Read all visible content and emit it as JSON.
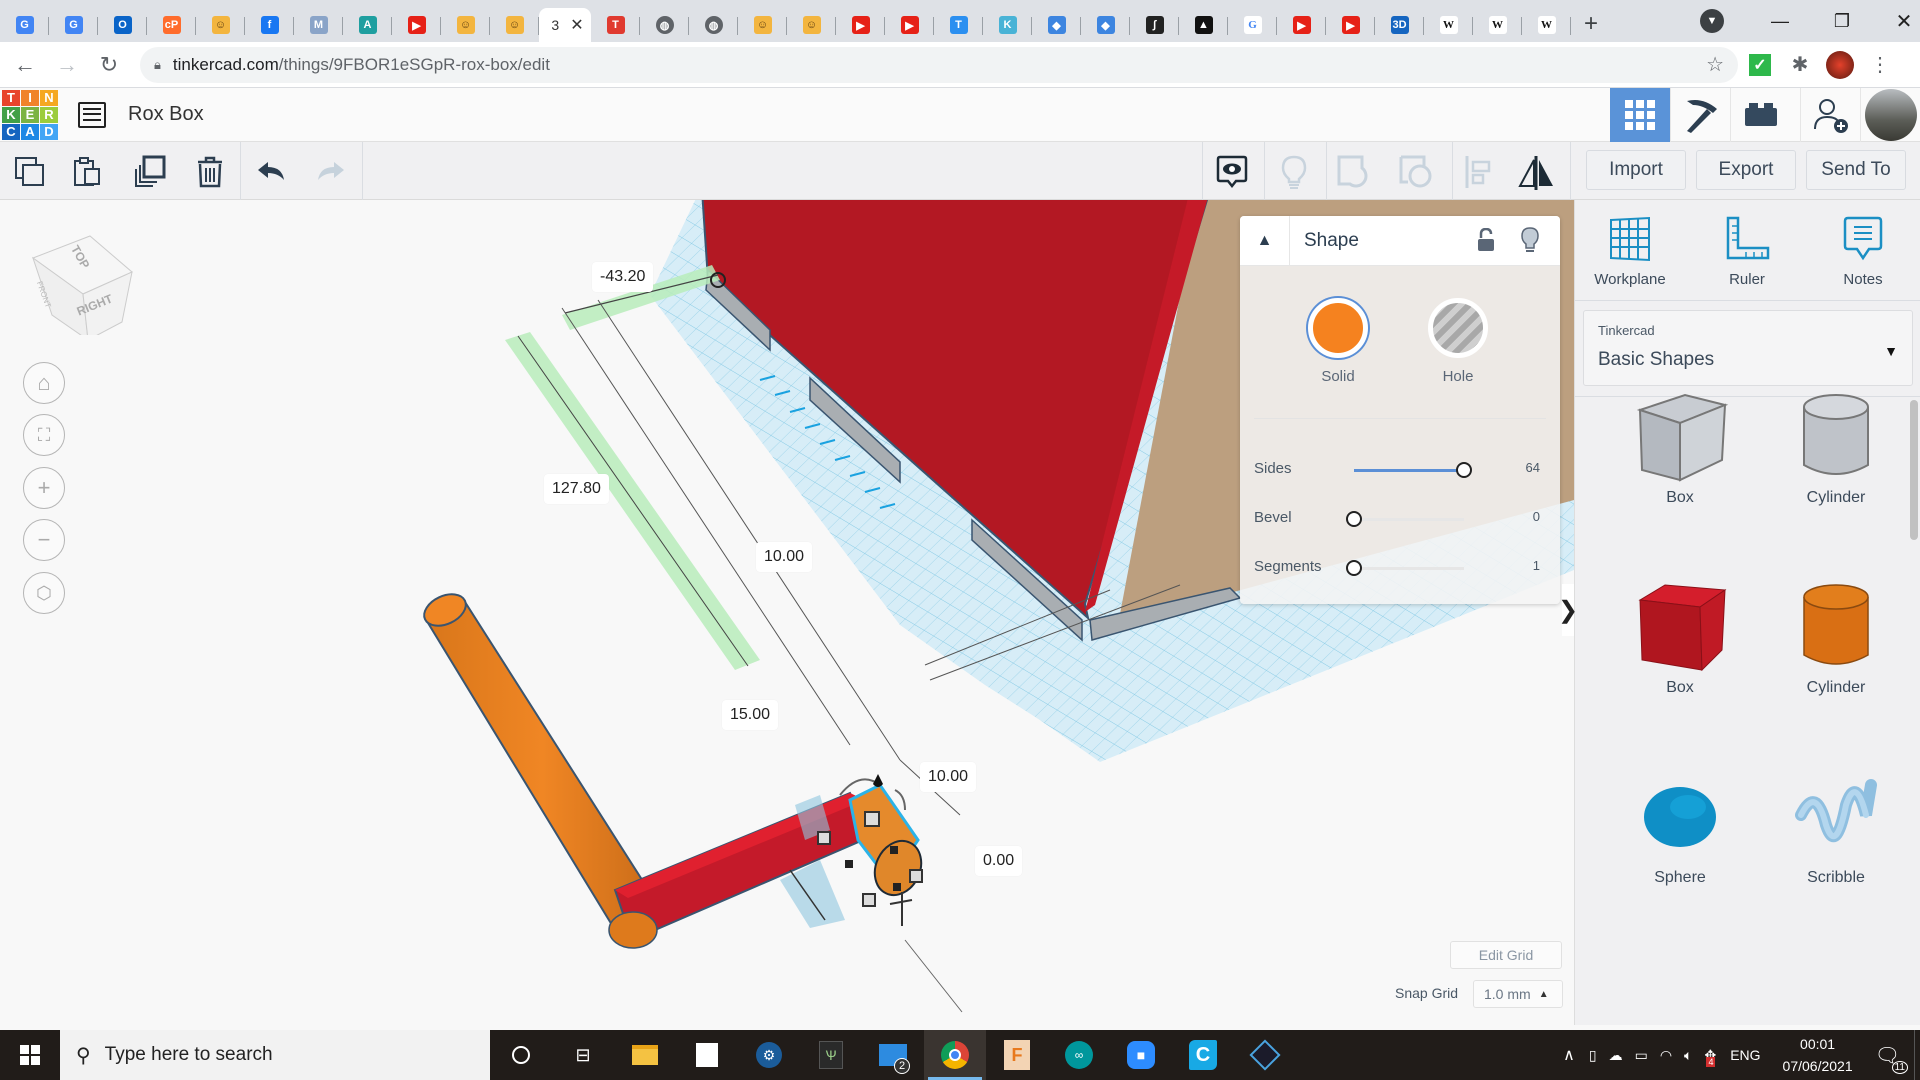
{
  "browser": {
    "tabs": [
      {
        "icon": "google-translate-icon",
        "color": "#4285f4",
        "glyph": "G"
      },
      {
        "icon": "google-translate-icon",
        "color": "#4285f4",
        "glyph": "G"
      },
      {
        "icon": "outlook-icon",
        "color": "#0a64c8",
        "glyph": "O"
      },
      {
        "icon": "cpanel-icon",
        "color": "#ff6c2c",
        "glyph": "cP"
      },
      {
        "icon": "robot-avatar-icon",
        "color": "#f3b53f",
        "glyph": "☺"
      },
      {
        "icon": "facebook-icon",
        "color": "#1877f2",
        "glyph": "f"
      },
      {
        "icon": "moodle-icon",
        "color": "#8aa4c8",
        "glyph": "M"
      },
      {
        "icon": "autodesk-icon",
        "color": "#1f9fa0",
        "glyph": "A"
      },
      {
        "icon": "youtube-icon",
        "color": "#e62117",
        "glyph": "▶"
      },
      {
        "icon": "robot-avatar-icon",
        "color": "#f3b53f",
        "glyph": "☺"
      },
      {
        "icon": "robot-avatar-icon",
        "color": "#f3b53f",
        "glyph": "☺"
      },
      {
        "icon": "active-tab",
        "color": "#ffffff",
        "glyph": "3",
        "active": true
      },
      {
        "icon": "tinkercad-icon",
        "color": "#e03a2f",
        "glyph": "T"
      },
      {
        "icon": "globe-icon",
        "color": "#5f6368",
        "glyph": "◍"
      },
      {
        "icon": "globe-icon",
        "color": "#5f6368",
        "glyph": "◍"
      },
      {
        "icon": "robot-avatar-icon",
        "color": "#f3b53f",
        "glyph": "☺"
      },
      {
        "icon": "robot-avatar-icon",
        "color": "#f3b53f",
        "glyph": "☺"
      },
      {
        "icon": "youtube-icon",
        "color": "#e62117",
        "glyph": "▶"
      },
      {
        "icon": "youtube-icon",
        "color": "#e62117",
        "glyph": "▶"
      },
      {
        "icon": "tinkercad-t-icon",
        "color": "#2b8ff0",
        "glyph": "T"
      },
      {
        "icon": "kidcode-icon",
        "color": "#49b3d6",
        "glyph": "K"
      },
      {
        "icon": "book-icon",
        "color": "#3d85e0",
        "glyph": "◆"
      },
      {
        "icon": "book-icon",
        "color": "#3d85e0",
        "glyph": "◆"
      },
      {
        "icon": "integral-icon",
        "color": "#222222",
        "glyph": "∫"
      },
      {
        "icon": "inkscape-icon",
        "color": "#111111",
        "glyph": "▲"
      },
      {
        "icon": "google-icon",
        "color": "#ffffff",
        "glyph": "G"
      },
      {
        "icon": "youtube-icon",
        "color": "#e62117",
        "glyph": "▶"
      },
      {
        "icon": "youtube-icon",
        "color": "#e62117",
        "glyph": "▶"
      },
      {
        "icon": "3d-icon",
        "color": "#1565c0",
        "glyph": "3D"
      },
      {
        "icon": "wikipedia-icon",
        "color": "#ffffff",
        "glyph": "W"
      },
      {
        "icon": "wikipedia-icon",
        "color": "#ffffff",
        "glyph": "W"
      },
      {
        "icon": "wikipedia-icon",
        "color": "#ffffff",
        "glyph": "W"
      }
    ],
    "active_tab_title": "3",
    "url_host": "tinkercad.com",
    "url_path": "/things/9FBOR1eSGpR-rox-box/edit"
  },
  "app": {
    "logo_letters": [
      "T",
      "I",
      "N",
      "K",
      "E",
      "R",
      "C",
      "A",
      "D"
    ],
    "logo_colors": [
      "#e8442c",
      "#f0832a",
      "#f5a821",
      "#43a047",
      "#7cb342",
      "#9ccc3c",
      "#1565c0",
      "#1e88e5",
      "#42a5f5"
    ],
    "design_title": "Rox Box",
    "accent": "#5a93d8"
  },
  "toolbar": {
    "import": "Import",
    "export": "Export",
    "send_to": "Send To"
  },
  "workspace_tools": {
    "workplane": "Workplane",
    "ruler": "Ruler",
    "notes": "Notes"
  },
  "library": {
    "provider": "Tinkercad",
    "category": "Basic Shapes",
    "shapes": [
      {
        "label": "Box",
        "kind": "box-hole"
      },
      {
        "label": "Cylinder",
        "kind": "cylinder-hole"
      },
      {
        "label": "Box",
        "kind": "box-red"
      },
      {
        "label": "Cylinder",
        "kind": "cylinder-orange"
      },
      {
        "label": "Sphere",
        "kind": "sphere-blue"
      },
      {
        "label": "Scribble",
        "kind": "scribble"
      }
    ]
  },
  "inspector": {
    "title": "Shape",
    "solid_label": "Solid",
    "hole_label": "Hole",
    "solid_color": "#f5821f",
    "properties": [
      {
        "label": "Sides",
        "value": "64",
        "fraction": 1.0
      },
      {
        "label": "Bevel",
        "value": "0",
        "fraction": 0.0
      },
      {
        "label": "Segments",
        "value": "1",
        "fraction": 0.0
      }
    ]
  },
  "viewcube": {
    "top": "TOP",
    "right": "RIGHT",
    "front": "FRONT"
  },
  "dimensions": {
    "d1": "-43.20",
    "d2": "127.80",
    "d3": "10.00",
    "d4": "15.00",
    "d5": "10.00",
    "d6": "0.00"
  },
  "grid": {
    "edit_label": "Edit Grid",
    "snap_label": "Snap Grid",
    "snap_value": "1.0 mm"
  },
  "taskbar": {
    "search_placeholder": "Type here to search",
    "mail_badge": "2",
    "language": "ENG",
    "time": "00:01",
    "date": "07/06/2021",
    "notification_count": "11",
    "tray_badge": "4"
  }
}
